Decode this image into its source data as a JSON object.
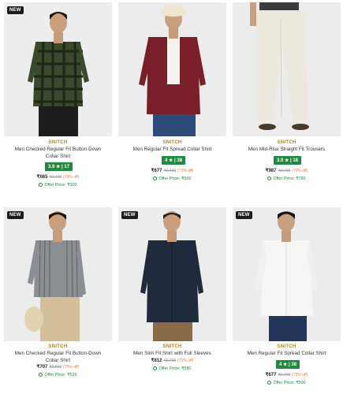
{
  "products": [
    {
      "badge": "NEW",
      "brand": "SNITCH",
      "title": "Men Checked Regular Fit Button-Down Collar Shirt",
      "rating": "3.9 ★ | 17",
      "price": "₹665",
      "mrp": "₹2,469",
      "discount": "(73% off)",
      "offer": "Offer Price: ₹300"
    },
    {
      "badge": "",
      "brand": "SNITCH",
      "title": "Men Regular Fit Spread Collar Shirt",
      "rating": "4 ★ | 38",
      "price": "₹677",
      "mrp": "₹2,469",
      "discount": "(73% off)",
      "offer": "Offer Price: ₹500"
    },
    {
      "badge": "",
      "brand": "SNITCH",
      "title": "Men Mid-Rise Straight Fit Trousers",
      "rating": "3.9 ★ | 18",
      "price": "₹987",
      "mrp": "₹2,799",
      "discount": "(70% off)",
      "offer": "Offer Price: ₹780"
    },
    {
      "badge": "NEW",
      "brand": "SNITCH",
      "title": "Men Checked Regular Fit Button-Down Collar Shirt",
      "rating": "",
      "price": "₹707",
      "mrp": "₹2,869",
      "discount": "(75% off)",
      "offer": "Offer Price: ₹520"
    },
    {
      "badge": "NEW",
      "brand": "SNITCH",
      "title": "Men Slim Fit Shirt with Full Sleeves",
      "rating": "",
      "price": "₹812",
      "mrp": "₹2,799",
      "discount": "(71% off)",
      "offer": "Offer Price: ₹580"
    },
    {
      "badge": "NEW",
      "brand": "SNITCH",
      "title": "Men Regular Fit Spread Collar Shirt",
      "rating": "4 ★ | 38",
      "price": "₹677",
      "mrp": "₹2,469",
      "discount": "(73% off)",
      "offer": "Offer Price: ₹500"
    }
  ],
  "colors": {
    "brand": "#b0821e",
    "rating_bg": "#1f8a3d",
    "offer": "#1f8a3d",
    "discount": "#e07b2c"
  }
}
